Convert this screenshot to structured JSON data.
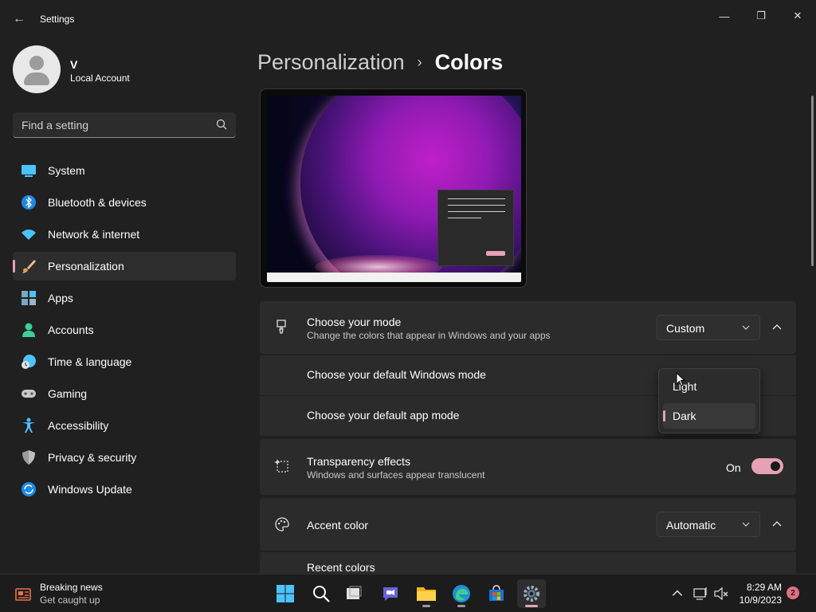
{
  "window": {
    "title": "Settings",
    "back_glyph": "←",
    "controls": {
      "minimize": "—",
      "maximize": "❐",
      "close": "✕"
    }
  },
  "user": {
    "name": "V",
    "account_type": "Local Account"
  },
  "search": {
    "placeholder": "Find a setting",
    "icon": "search-icon"
  },
  "sidebar": {
    "items": [
      {
        "label": "System",
        "icon": "system-icon",
        "active": false
      },
      {
        "label": "Bluetooth & devices",
        "icon": "bluetooth-icon",
        "active": false
      },
      {
        "label": "Network & internet",
        "icon": "wifi-icon",
        "active": false
      },
      {
        "label": "Personalization",
        "icon": "brush-icon",
        "active": true
      },
      {
        "label": "Apps",
        "icon": "apps-icon",
        "active": false
      },
      {
        "label": "Accounts",
        "icon": "person-icon",
        "active": false
      },
      {
        "label": "Time & language",
        "icon": "clock-globe-icon",
        "active": false
      },
      {
        "label": "Gaming",
        "icon": "gamepad-icon",
        "active": false
      },
      {
        "label": "Accessibility",
        "icon": "accessibility-icon",
        "active": false
      },
      {
        "label": "Privacy & security",
        "icon": "shield-icon",
        "active": false
      },
      {
        "label": "Windows Update",
        "icon": "update-icon",
        "active": false
      }
    ]
  },
  "breadcrumb": {
    "parent": "Personalization",
    "separator": "›",
    "current": "Colors"
  },
  "mode_card": {
    "title": "Choose your mode",
    "description": "Change the colors that appear in Windows and your apps",
    "value": "Custom",
    "windows_mode_label": "Choose your default Windows mode",
    "app_mode_label": "Choose your default app mode"
  },
  "mode_popup": {
    "options": [
      {
        "label": "Light",
        "selected": false
      },
      {
        "label": "Dark",
        "selected": true
      }
    ]
  },
  "transparency_card": {
    "title": "Transparency effects",
    "description": "Windows and surfaces appear translucent",
    "state_label": "On",
    "enabled": true
  },
  "accent_card": {
    "title": "Accent color",
    "value": "Automatic",
    "recent_colors_label": "Recent colors"
  },
  "taskbar": {
    "news_title": "Breaking news",
    "news_subtitle": "Get caught up",
    "apps": [
      "windows-start-icon",
      "search-icon",
      "task-view-icon",
      "chat-icon",
      "file-explorer-icon",
      "edge-icon",
      "store-icon",
      "settings-icon"
    ],
    "time": "8:29 AM",
    "date": "10/9/2023",
    "notification_count": "2"
  },
  "colors": {
    "accent": "#e6a2b5",
    "background": "#202020",
    "card": "#2b2b2b"
  }
}
